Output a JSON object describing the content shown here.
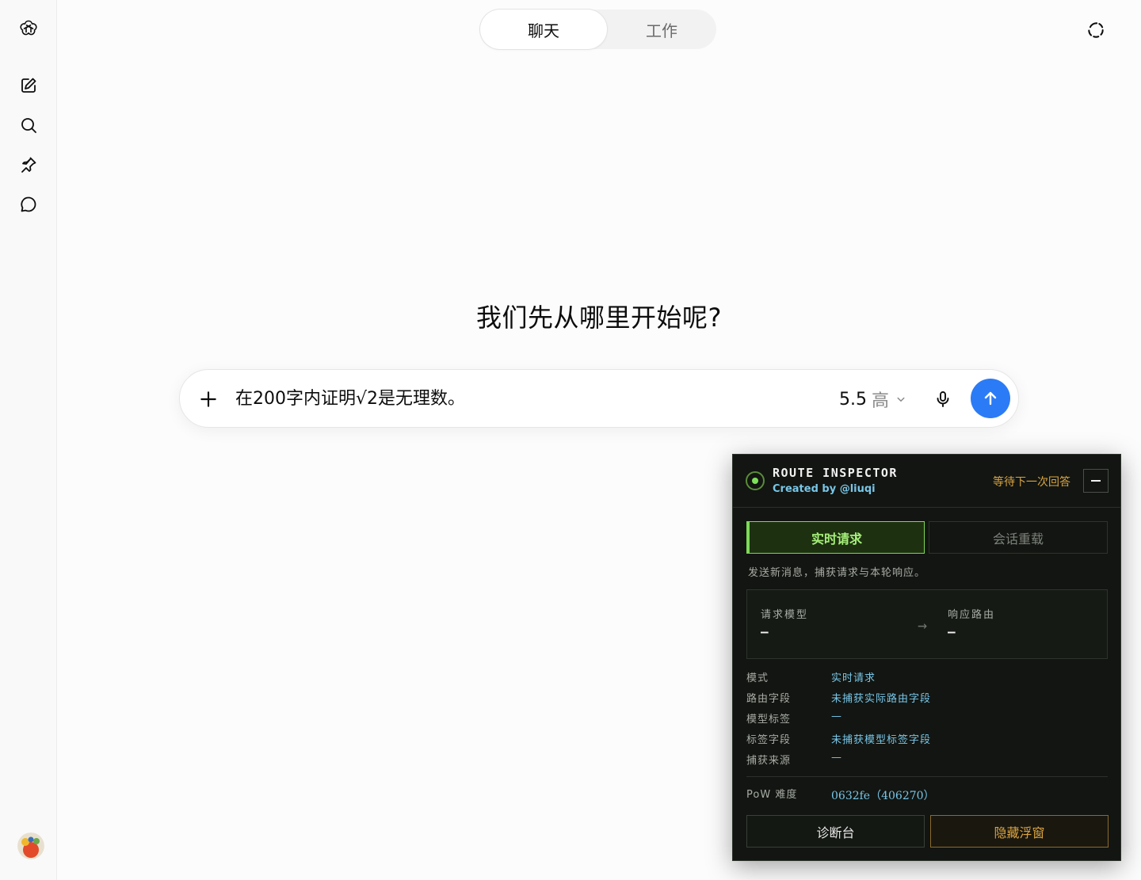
{
  "sidebar": {
    "items": [
      {
        "icon": "openai-logo-icon"
      },
      {
        "icon": "new-chat-icon"
      },
      {
        "icon": "search-icon"
      },
      {
        "icon": "pin-icon"
      },
      {
        "icon": "chat-bubble-icon"
      }
    ],
    "avatar_icon": "user-avatar"
  },
  "header": {
    "tabs": [
      {
        "label": "聊天",
        "active": true
      },
      {
        "label": "工作",
        "active": false
      }
    ],
    "right_icon": "temporary-chat-icon"
  },
  "main": {
    "greeting": "我们先从哪里开始呢?"
  },
  "composer": {
    "input_value": "在200字内证明√2是无理数。",
    "model_version": "5.5",
    "model_level": "高",
    "send_color": "#2b7bf6"
  },
  "inspector": {
    "title": "ROUTE INSPECTOR",
    "subtitle": "Created by @liuqi",
    "status": "等待下一次回答",
    "tabs": [
      {
        "label": "实时请求",
        "active": true
      },
      {
        "label": "会话重载",
        "active": false
      }
    ],
    "hint": "发送新消息，捕获请求与本轮响应。",
    "request_model_label": "请求模型",
    "request_model_value": "—",
    "response_route_label": "响应路由",
    "response_route_value": "—",
    "rows": [
      {
        "key": "模式",
        "value": "实时请求"
      },
      {
        "key": "路由字段",
        "value": "未捕获实际路由字段"
      },
      {
        "key": "模型标签",
        "value": "—"
      },
      {
        "key": "标签字段",
        "value": "未捕获模型标签字段"
      },
      {
        "key": "捕获来源",
        "value": "—"
      }
    ],
    "pow_label": "PoW 难度",
    "pow_value": "0632fe（406270）",
    "diag_button": "诊断台",
    "hide_button": "隐藏浮窗",
    "accent_color": "#7ed957",
    "warn_color": "#d9a441"
  }
}
